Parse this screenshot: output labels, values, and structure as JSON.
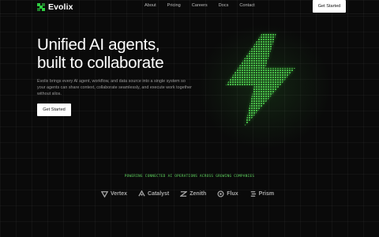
{
  "brand": {
    "name": "Evolix",
    "logo_color": "#2ecc40"
  },
  "nav": {
    "links": [
      "About",
      "Pricing",
      "Careers",
      "Docs",
      "Contact"
    ],
    "cta_label": "Get Started"
  },
  "hero": {
    "headline_line1": "Unified AI agents,",
    "headline_line2": "built to collaborate",
    "subtext": "Evolix brings every AI agent, workflow, and data source into a single system so your agents can share context, collaborate seamlessly, and execute work together without silos.",
    "cta_label": "Get Started",
    "accent_color": "#3fbf3f"
  },
  "partners": {
    "title": "POWERING CONNECTED AI OPERATIONS ACROSS GROWING COMPANIES",
    "logos": [
      {
        "name": "Vertex",
        "icon": "vertex-icon"
      },
      {
        "name": "Catalyst",
        "icon": "catalyst-icon"
      },
      {
        "name": "Zenith",
        "icon": "zenith-icon"
      },
      {
        "name": "Flux",
        "icon": "flux-icon"
      },
      {
        "name": "Prism",
        "icon": "prism-icon"
      }
    ]
  }
}
